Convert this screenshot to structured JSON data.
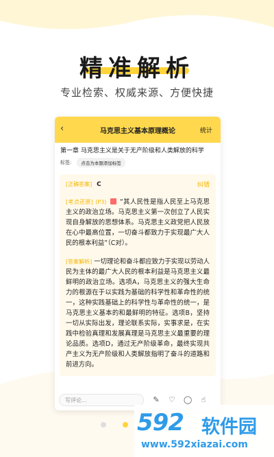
{
  "hero": {
    "title": "精准解析",
    "subtitle": "专业检索、权威来源、方便快捷"
  },
  "phone": {
    "nav": {
      "back_icon": "chevron-left-icon",
      "title": "马克思主义基本原理概论",
      "right_label": "统计"
    },
    "question": "第一章 马克思主义是关于无产阶级和人类解放的科学",
    "tags": {
      "label": "标签:",
      "add_button": "点击为本题添加标签"
    },
    "answer": {
      "tag": "[正确答案]",
      "value": "C",
      "report": "纠错"
    },
    "origin": {
      "tag": "[考点还原]",
      "page_ref": "(P3)",
      "text": "“其人民性是指人民至上马克思主义的政治立场。马克思主义第一次创立了人民实现自身解放的思想体系。马克思主义政党把人民放在心中最高位置，一切奋斗都致力于实现最广大人民的根本利益”（C对）。"
    },
    "analysis": {
      "tag": "[答案解析]",
      "text": "一切理论和奋斗都应致力于实现以劳动人民为主体的最广大人民的根本利益是马克思主义最鲜明的政治立场。选项A，马克思主义的强大生命力的根源在于以实践为基础的科学性和革命性的统一，这种实践基础上的科学性与革命性的统一，是马克思主义基本的和最鲜明的特征。选项B，坚持一切从实际出发，理论联系实际，实事求是，在实践中检验真理和发展真理是马克思主义最重要的理论品质。选项D，通过无产阶级革命，最终实现共产主义为无产阶级和人类解放指明了奋斗的道路和前进方向。"
    },
    "bottom_bar": {
      "comment_placeholder": "写评论...",
      "icons": [
        "edit-icon",
        "heart-icon",
        "comment-icon",
        "like-icon"
      ]
    }
  },
  "pager": {
    "count": 3,
    "active": 2
  },
  "watermark": {
    "logo": "592",
    "name": "软件园",
    "url": "www.592xiazai.com"
  },
  "colors": {
    "accent": "#ffd43b",
    "nav": "#ffd84d",
    "tag": "#f5b700",
    "card": "#fff9ec",
    "watermark": "#2f9be8"
  }
}
